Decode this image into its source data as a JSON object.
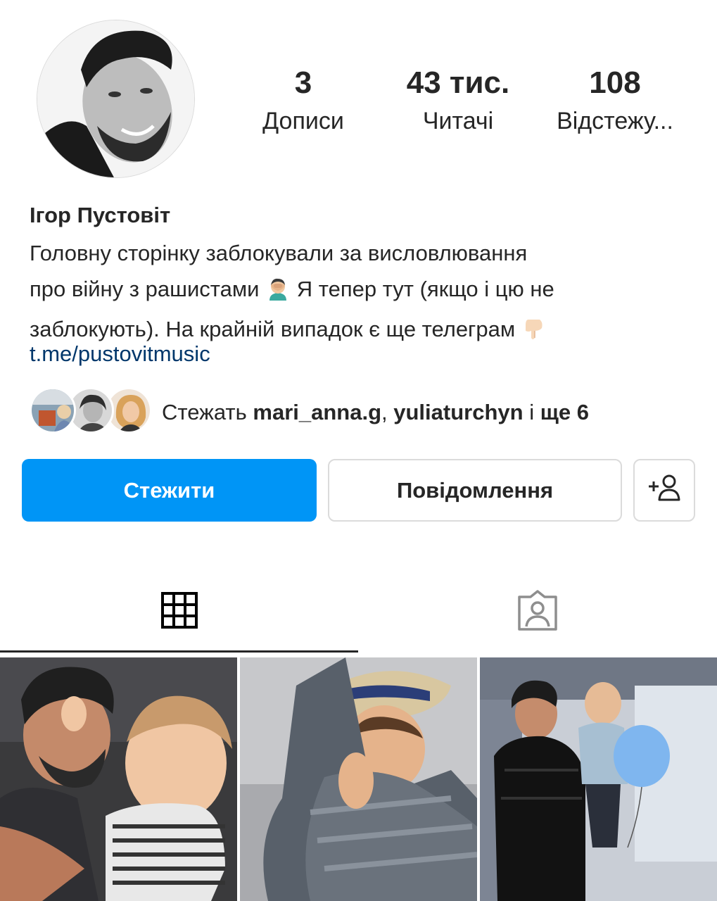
{
  "profile": {
    "name": "Ігор Пустовіт",
    "bio_line1": "Головну сторінку заблокували за висловлювання",
    "bio_line2a": "про війну з рашистами",
    "bio_line2b": "Я тепер тут (якщо і цю не",
    "bio_line3": "заблокують). На крайній випадок є ще телеграм",
    "link": "t.me/pustovitmusic"
  },
  "stats": {
    "posts": {
      "value": "3",
      "label": "Дописи"
    },
    "followers": {
      "value": "43 тис.",
      "label": "Читачі"
    },
    "following": {
      "value": "108",
      "label": "Відстежу..."
    }
  },
  "followed_by": {
    "prefix": "Стежать ",
    "user1": "mari_anna.g",
    "sep": ", ",
    "user2": "yuliaturchyn",
    "conj": " і ",
    "more": "ще 6"
  },
  "buttons": {
    "follow": "Стежити",
    "message": "Повідомлення"
  },
  "icons": {
    "emoji_facepalm": "man-facepalming-emoji",
    "emoji_pointing_down": "pointing-down-emoji",
    "add_user": "add-user-icon",
    "grid": "grid-icon",
    "tagged": "tagged-person-icon"
  },
  "colors": {
    "primary": "#0095f6",
    "link": "#00376b",
    "text": "#262626",
    "border": "#dbdbdb"
  }
}
